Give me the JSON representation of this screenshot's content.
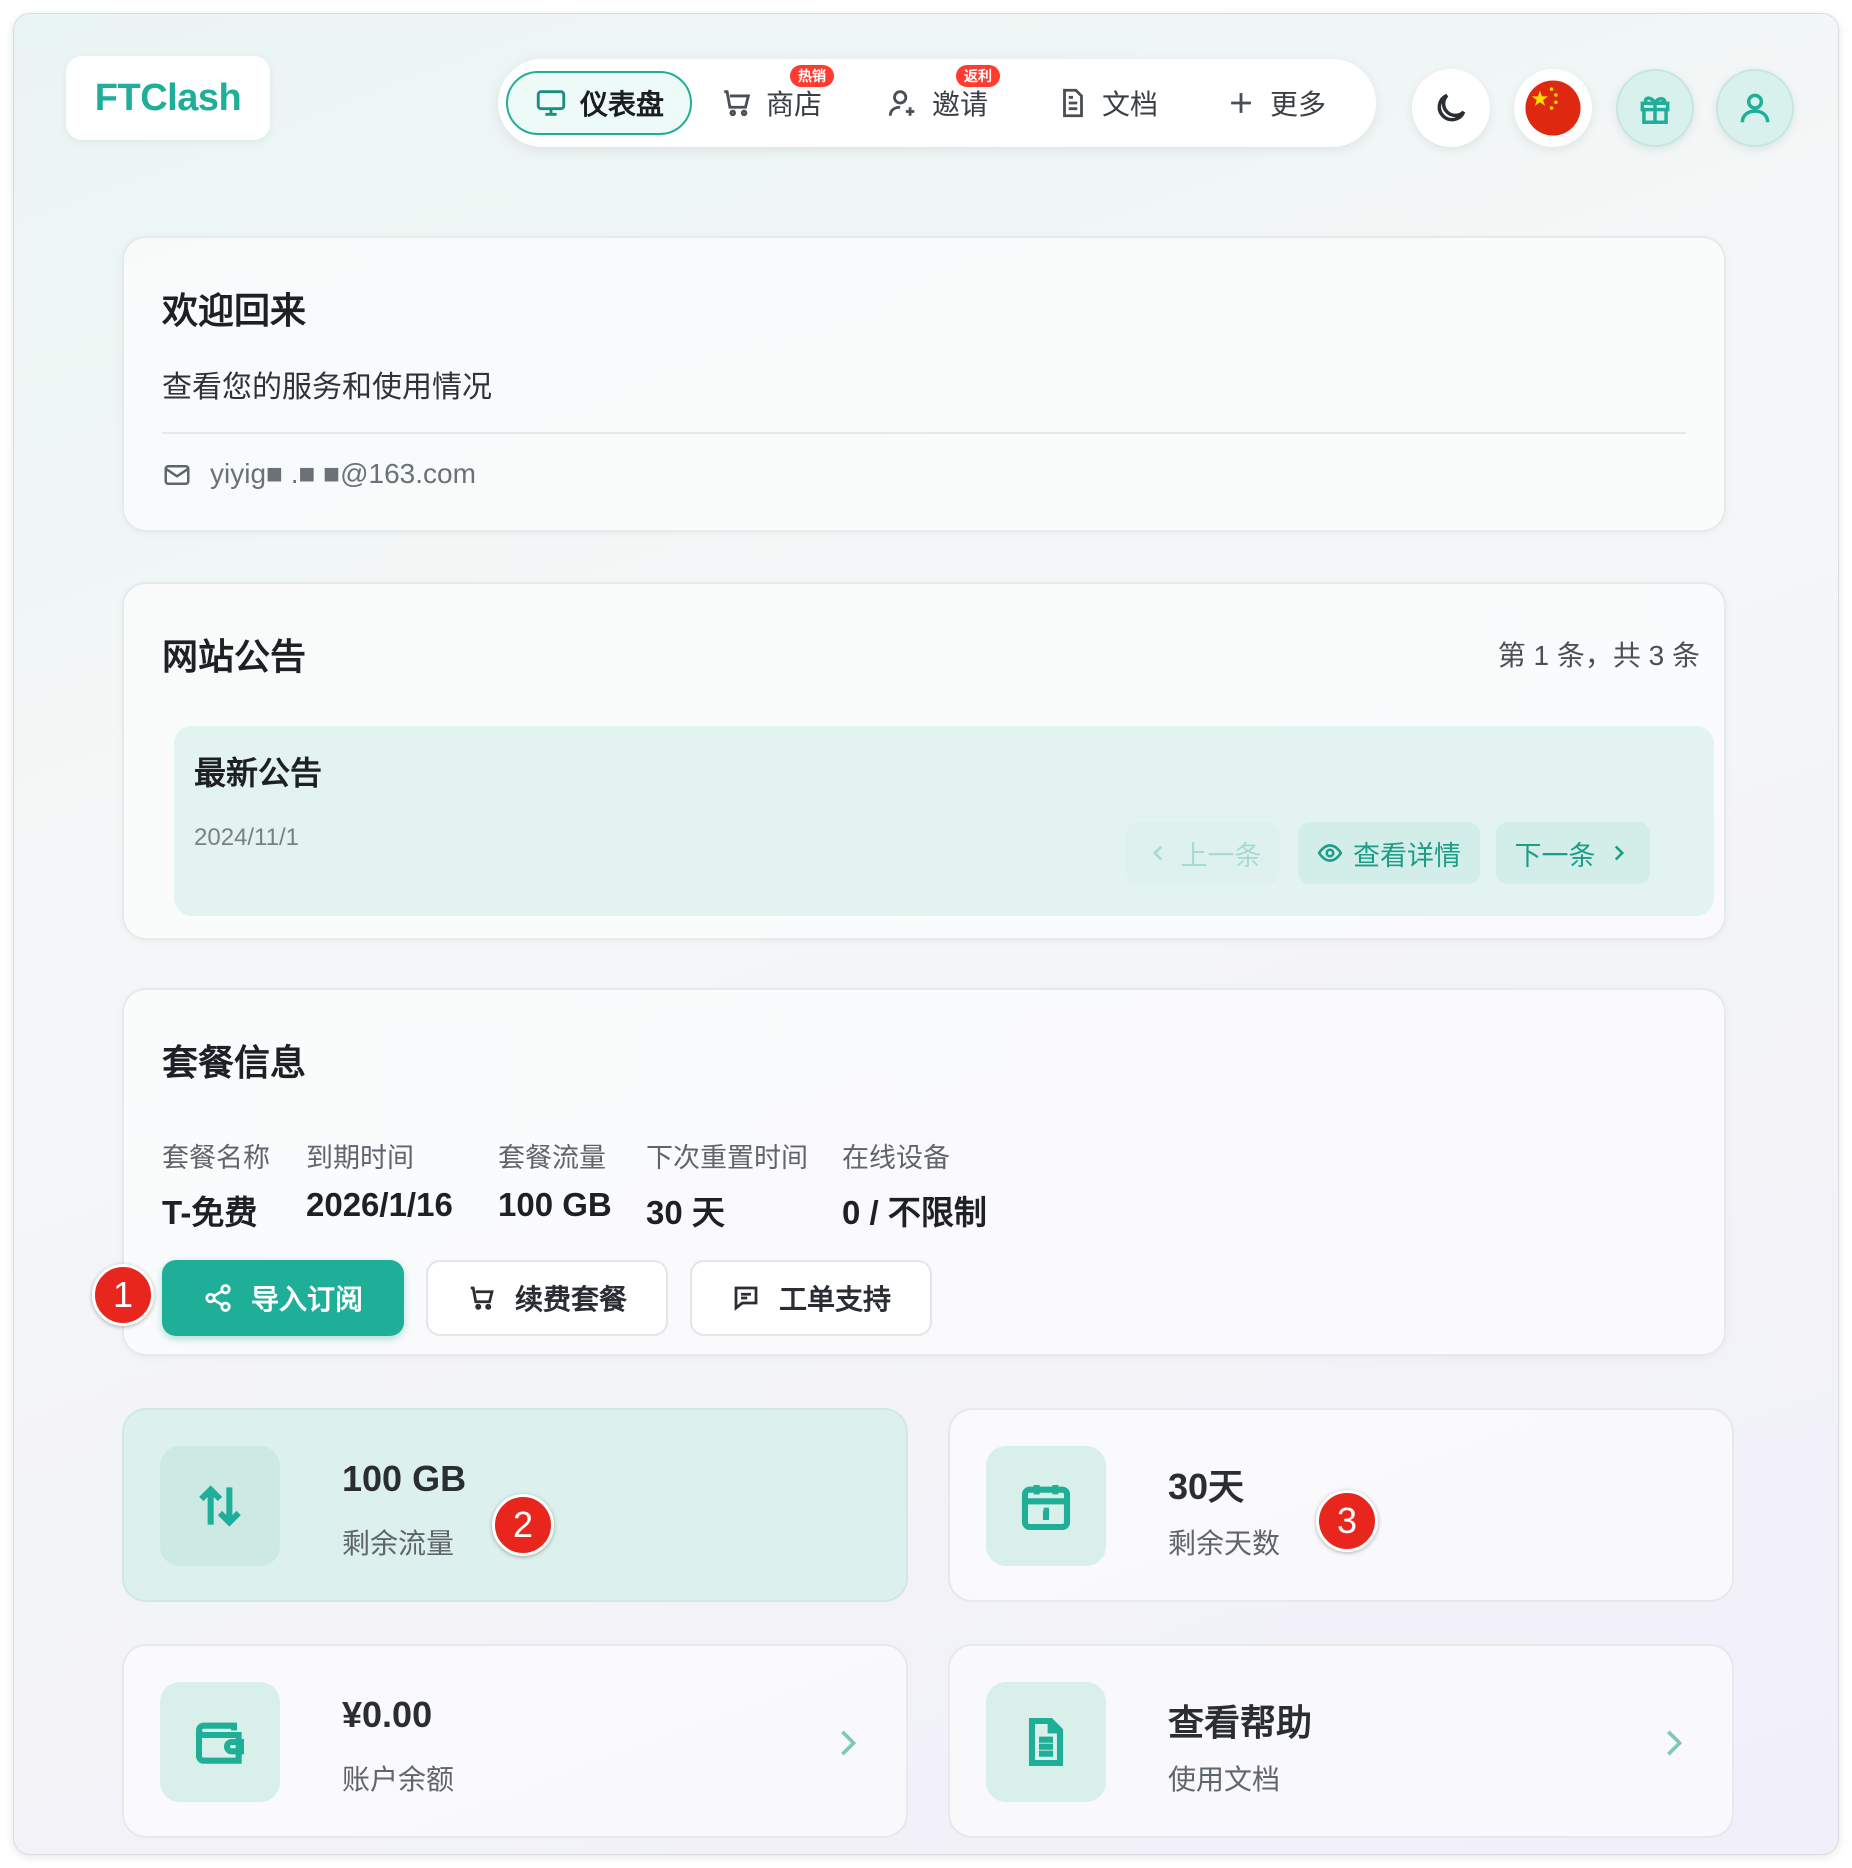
{
  "brand": {
    "name": "FTClash",
    "accent": "#1fae97"
  },
  "nav": {
    "items": [
      {
        "label": "仪表盘",
        "icon": "monitor-icon",
        "active": true
      },
      {
        "label": "商店",
        "icon": "cart-icon",
        "badge": "热销"
      },
      {
        "label": "邀请",
        "icon": "user-plus-icon",
        "badge": "返利"
      },
      {
        "label": "文档",
        "icon": "document-icon"
      },
      {
        "label": "更多",
        "icon": "plus-icon"
      }
    ]
  },
  "header_actions": [
    "moon-icon",
    "china-flag-icon",
    "gift-icon",
    "user-icon"
  ],
  "welcome": {
    "title": "欢迎回来",
    "subtitle": "查看您的服务和使用情况",
    "email": "yiyig■ .■ ■@163.com"
  },
  "announcements": {
    "title": "网站公告",
    "counter": "第 1 条，共 3 条",
    "item": {
      "title": "最新公告",
      "date": "2024/11/1"
    },
    "prev_label": "上一条",
    "view_label": "查看详情",
    "next_label": "下一条"
  },
  "plan": {
    "title": "套餐信息",
    "fields": [
      {
        "label": "套餐名称",
        "value": "T-免费"
      },
      {
        "label": "到期时间",
        "value": "2026/1/16"
      },
      {
        "label": "套餐流量",
        "value": "100 GB"
      },
      {
        "label": "下次重置时间",
        "value": "30 天"
      },
      {
        "label": "在线设备",
        "value": "0 / 不限制"
      }
    ],
    "buttons": {
      "import": "导入订阅",
      "renew": "续费套餐",
      "ticket": "工单支持"
    }
  },
  "stats": {
    "traffic": {
      "value": "100 GB",
      "label": "剩余流量"
    },
    "days": {
      "value": "30天",
      "label": "剩余天数"
    },
    "balance": {
      "value": "¥0.00",
      "label": "账户余额"
    },
    "help": {
      "value": "查看帮助",
      "label": "使用文档"
    }
  },
  "markers": [
    "1",
    "2",
    "3"
  ]
}
